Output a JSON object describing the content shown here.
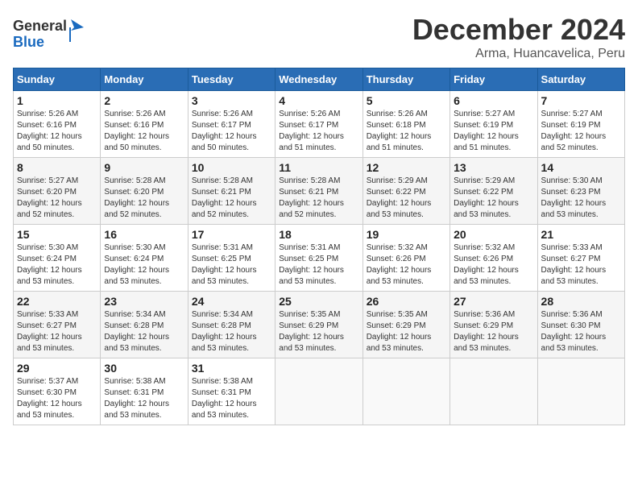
{
  "header": {
    "logo_general": "General",
    "logo_blue": "Blue",
    "month_title": "December 2024",
    "location": "Arma, Huancavelica, Peru"
  },
  "days_of_week": [
    "Sunday",
    "Monday",
    "Tuesday",
    "Wednesday",
    "Thursday",
    "Friday",
    "Saturday"
  ],
  "weeks": [
    [
      {
        "day": "1",
        "sunrise": "5:26 AM",
        "sunset": "6:16 PM",
        "daylight": "12 hours and 50 minutes."
      },
      {
        "day": "2",
        "sunrise": "5:26 AM",
        "sunset": "6:16 PM",
        "daylight": "12 hours and 50 minutes."
      },
      {
        "day": "3",
        "sunrise": "5:26 AM",
        "sunset": "6:17 PM",
        "daylight": "12 hours and 50 minutes."
      },
      {
        "day": "4",
        "sunrise": "5:26 AM",
        "sunset": "6:17 PM",
        "daylight": "12 hours and 51 minutes."
      },
      {
        "day": "5",
        "sunrise": "5:26 AM",
        "sunset": "6:18 PM",
        "daylight": "12 hours and 51 minutes."
      },
      {
        "day": "6",
        "sunrise": "5:27 AM",
        "sunset": "6:19 PM",
        "daylight": "12 hours and 51 minutes."
      },
      {
        "day": "7",
        "sunrise": "5:27 AM",
        "sunset": "6:19 PM",
        "daylight": "12 hours and 52 minutes."
      }
    ],
    [
      {
        "day": "8",
        "sunrise": "5:27 AM",
        "sunset": "6:20 PM",
        "daylight": "12 hours and 52 minutes."
      },
      {
        "day": "9",
        "sunrise": "5:28 AM",
        "sunset": "6:20 PM",
        "daylight": "12 hours and 52 minutes."
      },
      {
        "day": "10",
        "sunrise": "5:28 AM",
        "sunset": "6:21 PM",
        "daylight": "12 hours and 52 minutes."
      },
      {
        "day": "11",
        "sunrise": "5:28 AM",
        "sunset": "6:21 PM",
        "daylight": "12 hours and 52 minutes."
      },
      {
        "day": "12",
        "sunrise": "5:29 AM",
        "sunset": "6:22 PM",
        "daylight": "12 hours and 53 minutes."
      },
      {
        "day": "13",
        "sunrise": "5:29 AM",
        "sunset": "6:22 PM",
        "daylight": "12 hours and 53 minutes."
      },
      {
        "day": "14",
        "sunrise": "5:30 AM",
        "sunset": "6:23 PM",
        "daylight": "12 hours and 53 minutes."
      }
    ],
    [
      {
        "day": "15",
        "sunrise": "5:30 AM",
        "sunset": "6:24 PM",
        "daylight": "12 hours and 53 minutes."
      },
      {
        "day": "16",
        "sunrise": "5:30 AM",
        "sunset": "6:24 PM",
        "daylight": "12 hours and 53 minutes."
      },
      {
        "day": "17",
        "sunrise": "5:31 AM",
        "sunset": "6:25 PM",
        "daylight": "12 hours and 53 minutes."
      },
      {
        "day": "18",
        "sunrise": "5:31 AM",
        "sunset": "6:25 PM",
        "daylight": "12 hours and 53 minutes."
      },
      {
        "day": "19",
        "sunrise": "5:32 AM",
        "sunset": "6:26 PM",
        "daylight": "12 hours and 53 minutes."
      },
      {
        "day": "20",
        "sunrise": "5:32 AM",
        "sunset": "6:26 PM",
        "daylight": "12 hours and 53 minutes."
      },
      {
        "day": "21",
        "sunrise": "5:33 AM",
        "sunset": "6:27 PM",
        "daylight": "12 hours and 53 minutes."
      }
    ],
    [
      {
        "day": "22",
        "sunrise": "5:33 AM",
        "sunset": "6:27 PM",
        "daylight": "12 hours and 53 minutes."
      },
      {
        "day": "23",
        "sunrise": "5:34 AM",
        "sunset": "6:28 PM",
        "daylight": "12 hours and 53 minutes."
      },
      {
        "day": "24",
        "sunrise": "5:34 AM",
        "sunset": "6:28 PM",
        "daylight": "12 hours and 53 minutes."
      },
      {
        "day": "25",
        "sunrise": "5:35 AM",
        "sunset": "6:29 PM",
        "daylight": "12 hours and 53 minutes."
      },
      {
        "day": "26",
        "sunrise": "5:35 AM",
        "sunset": "6:29 PM",
        "daylight": "12 hours and 53 minutes."
      },
      {
        "day": "27",
        "sunrise": "5:36 AM",
        "sunset": "6:29 PM",
        "daylight": "12 hours and 53 minutes."
      },
      {
        "day": "28",
        "sunrise": "5:36 AM",
        "sunset": "6:30 PM",
        "daylight": "12 hours and 53 minutes."
      }
    ],
    [
      {
        "day": "29",
        "sunrise": "5:37 AM",
        "sunset": "6:30 PM",
        "daylight": "12 hours and 53 minutes."
      },
      {
        "day": "30",
        "sunrise": "5:38 AM",
        "sunset": "6:31 PM",
        "daylight": "12 hours and 53 minutes."
      },
      {
        "day": "31",
        "sunrise": "5:38 AM",
        "sunset": "6:31 PM",
        "daylight": "12 hours and 53 minutes."
      },
      null,
      null,
      null,
      null
    ]
  ],
  "labels": {
    "sunrise": "Sunrise:",
    "sunset": "Sunset:",
    "daylight": "Daylight:"
  }
}
